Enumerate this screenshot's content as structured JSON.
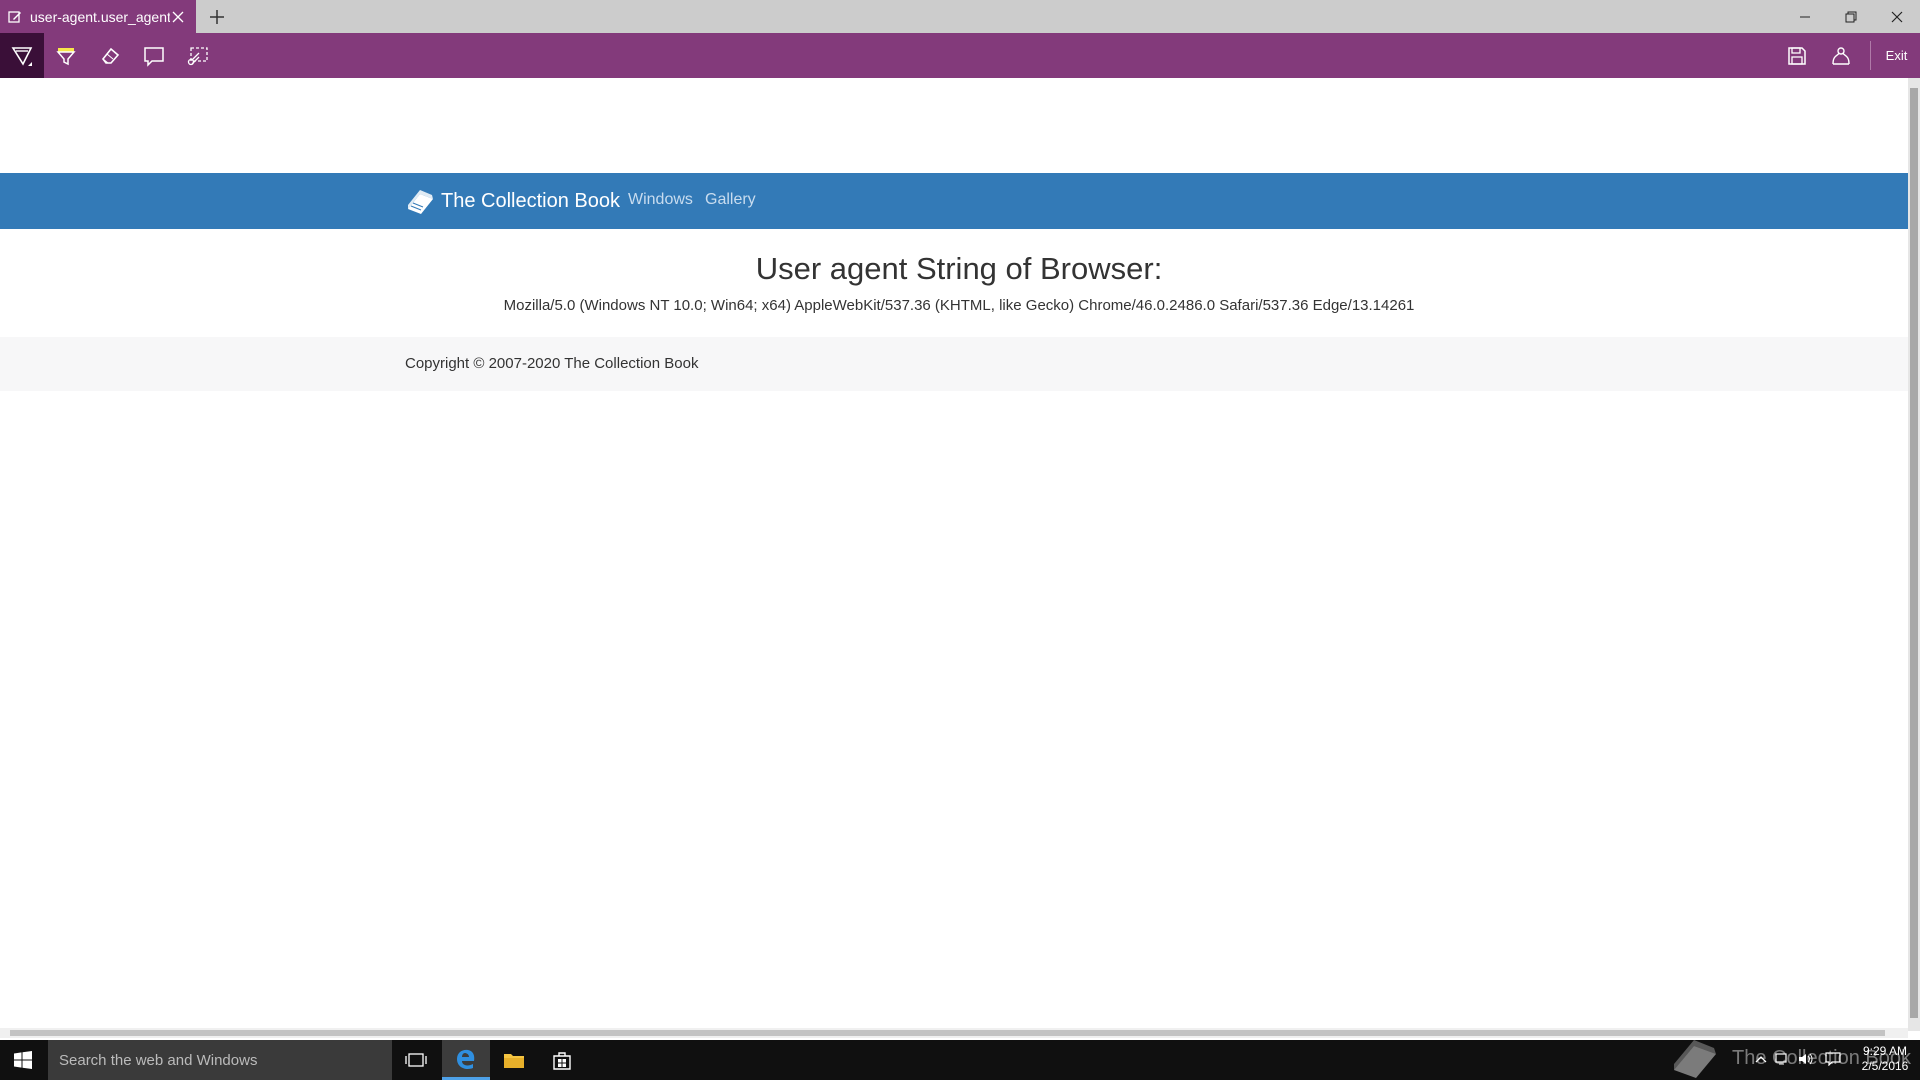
{
  "browser": {
    "tab_title": "user-agent.user_agent -",
    "exit_label": "Exit",
    "toolbar_tools": [
      "pen-tool",
      "highlighter-tool",
      "eraser-tool",
      "comment-tool",
      "clip-tool"
    ],
    "accent_color": "#833a7b"
  },
  "site": {
    "brand": "The Collection Book",
    "nav": [
      "Windows",
      "Gallery"
    ],
    "headline": "User agent String of Browser:",
    "user_agent": "Mozilla/5.0 (Windows NT 10.0; Win64; x64) AppleWebKit/537.36 (KHTML, like Gecko) Chrome/46.0.2486.0 Safari/537.36 Edge/13.14261",
    "footer": "Copyright © 2007-2020 The Collection Book",
    "navbar_color": "#337ab7"
  },
  "taskbar": {
    "search_placeholder": "Search the web and Windows",
    "watermark": "The Collection Book",
    "time": "9:29 AM",
    "date": "2/5/2016"
  }
}
